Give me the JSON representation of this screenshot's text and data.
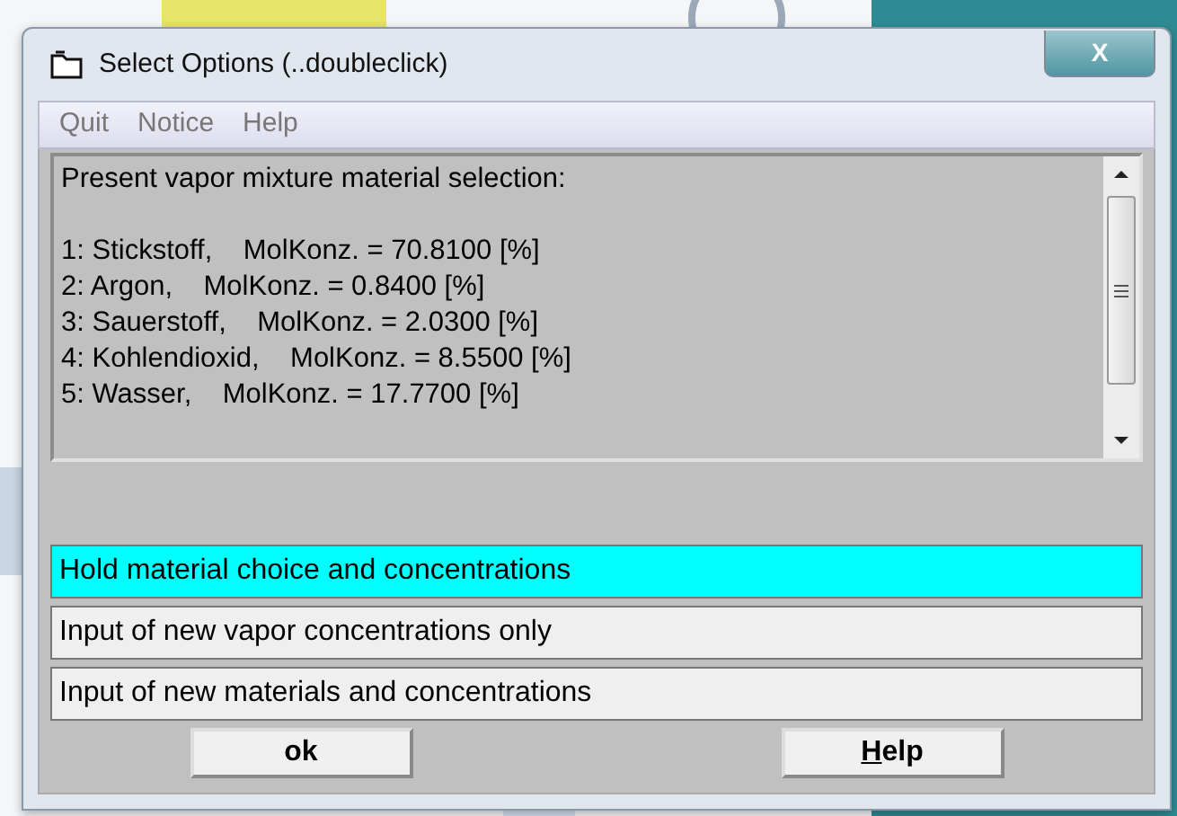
{
  "window": {
    "title": "Select Options (..doubleclick)",
    "close_label": "X"
  },
  "menu": [
    "Quit",
    "Notice",
    "Help"
  ],
  "selection_text": {
    "heading": "Present vapor mixture material selection:",
    "lines": [
      "1: Stickstoff,    MolKonz. = 70.8100 [%]",
      "2: Argon,    MolKonz. = 0.8400 [%]",
      "3: Sauerstoff,    MolKonz. = 2.0300 [%]",
      "4: Kohlendioxid,    MolKonz. = 8.5500 [%]",
      "5: Wasser,    MolKonz. = 17.7700 [%]"
    ]
  },
  "options": [
    {
      "label": "Hold material choice and concentrations",
      "selected": true
    },
    {
      "label": "Input of new vapor concentrations only",
      "selected": false
    },
    {
      "label": "Input of new materials and concentrations",
      "selected": false
    }
  ],
  "buttons": [
    {
      "label": "ok",
      "underline_first": false
    },
    {
      "label": "Help",
      "underline_first": true
    }
  ]
}
